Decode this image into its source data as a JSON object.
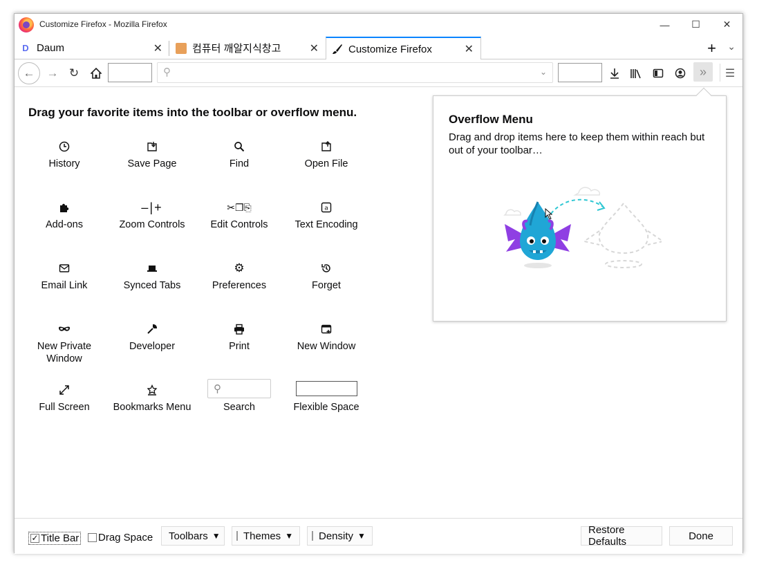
{
  "window": {
    "title": "Customize Firefox - Mozilla Firefox"
  },
  "tabs": [
    {
      "label": "Daum",
      "icon": "daum-favicon"
    },
    {
      "label": "컴퓨터 깨알지식창고",
      "icon": "blog-favicon"
    },
    {
      "label": "Customize Firefox",
      "icon": "paintbrush-icon",
      "active": true
    }
  ],
  "main": {
    "heading": "Drag your favorite items into the toolbar or overflow menu.",
    "palette": [
      {
        "label": "History",
        "icon": "clock-icon"
      },
      {
        "label": "Save Page",
        "icon": "save-page-icon"
      },
      {
        "label": "Find",
        "icon": "search-icon"
      },
      {
        "label": "Open File",
        "icon": "open-file-icon"
      },
      {
        "label": "Add-ons",
        "icon": "puzzle-icon"
      },
      {
        "label": "Zoom Controls",
        "icon": "zoom-icon"
      },
      {
        "label": "Edit Controls",
        "icon": "cut-copy-paste-icon"
      },
      {
        "label": "Text Encoding",
        "icon": "text-encoding-icon"
      },
      {
        "label": "Email Link",
        "icon": "envelope-icon"
      },
      {
        "label": "Synced Tabs",
        "icon": "synced-tabs-icon"
      },
      {
        "label": "Preferences",
        "icon": "gear-icon"
      },
      {
        "label": "Forget",
        "icon": "forget-icon"
      },
      {
        "label": "New Private Window",
        "icon": "mask-icon"
      },
      {
        "label": "Developer",
        "icon": "wrench-icon"
      },
      {
        "label": "Print",
        "icon": "printer-icon"
      },
      {
        "label": "New Window",
        "icon": "new-window-icon"
      },
      {
        "label": "Full Screen",
        "icon": "fullscreen-icon"
      },
      {
        "label": "Bookmarks Menu",
        "icon": "bookmarks-menu-icon"
      },
      {
        "label": "Search",
        "icon": "search-widget"
      },
      {
        "label": "Flexible Space",
        "icon": "flexible-space"
      }
    ]
  },
  "overflow_panel": {
    "title": "Overflow Menu",
    "description": "Drag and drop items here to keep them within reach but out of your toolbar…"
  },
  "footer": {
    "title_bar": {
      "label": "Title Bar",
      "checked": true
    },
    "drag_space": {
      "label": "Drag Space",
      "checked": false
    },
    "toolbars_label": "Toolbars",
    "themes_label": "Themes",
    "density_label": "Density",
    "restore_label": "Restore Defaults",
    "done_label": "Done"
  },
  "colors": {
    "accent": "#0a84ff",
    "dragon": "#20a6d6",
    "wings": "#8f3fe3"
  }
}
